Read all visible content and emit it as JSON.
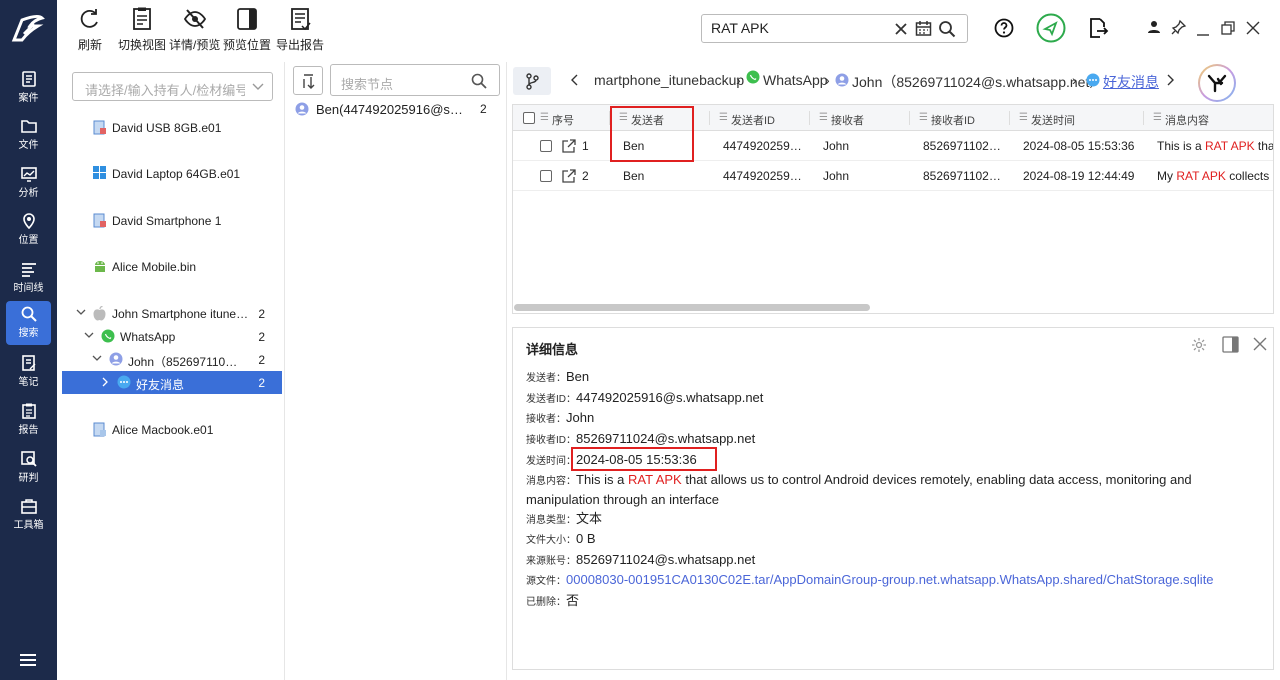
{
  "nav": {
    "items": [
      {
        "label": "案件",
        "icon": "case-icon"
      },
      {
        "label": "文件",
        "icon": "folder-icon"
      },
      {
        "label": "分析",
        "icon": "analysis-icon"
      },
      {
        "label": "位置",
        "icon": "location-icon"
      },
      {
        "label": "时间线",
        "icon": "timeline-icon"
      },
      {
        "label": "搜索",
        "icon": "search-icon"
      },
      {
        "label": "笔记",
        "icon": "note-icon"
      },
      {
        "label": "报告",
        "icon": "report-icon"
      },
      {
        "label": "研判",
        "icon": "judge-icon"
      },
      {
        "label": "工具箱",
        "icon": "toolbox-icon"
      }
    ],
    "active": "搜索"
  },
  "toolbar": {
    "refresh": "刷新",
    "switch_view": "切换视图",
    "detail_preview": "详情/预览",
    "preview_pos": "预览位置",
    "export_report": "导出报告"
  },
  "search": {
    "value": "RAT APK"
  },
  "tree": {
    "placeholder": "请选择/输入持有人/检材编号",
    "items": [
      {
        "label": "David USB 8GB.e01"
      },
      {
        "label": "David Laptop 64GB.e01"
      },
      {
        "label": "David Smartphone 1"
      },
      {
        "label": "Alice Mobile.bin"
      },
      {
        "label": "John Smartphone itunebackup",
        "count": "2"
      },
      {
        "label": "WhatsApp",
        "count": "2"
      },
      {
        "label": "John（85269711024@s.whatsapp.net）",
        "count": "2"
      },
      {
        "label": "好友消息",
        "count": "2"
      },
      {
        "label": "Alice Macbook.e01"
      }
    ]
  },
  "nodes": {
    "placeholder": "搜索节点",
    "items": [
      {
        "label": "Ben(447492025916@s.whatsapp.net)",
        "count": "2"
      }
    ]
  },
  "breadcrumb": {
    "part1": "martphone_itunebackup",
    "part2": "WhatsApp",
    "part3": "John（85269711024@s.whatsapp.net）",
    "part4": "好友消息"
  },
  "table": {
    "headers": [
      "序号",
      "发送者",
      "发送者ID",
      "接收者",
      "接收者ID",
      "发送时间",
      "消息内容"
    ],
    "rows": [
      {
        "no": "1",
        "sender": "Ben",
        "sender_id": "447492025916@s.whatsapp.net",
        "receiver": "John",
        "receiver_id": "85269711024@s.whatsapp.net",
        "time": "2024-08-05 15:53:36",
        "msg_pre": "This is a ",
        "msg_hl": "RAT APK",
        "msg_post": " that allows us to control Android devices remotely"
      },
      {
        "no": "2",
        "sender": "Ben",
        "sender_id": "447492025916@s.whatsapp.net",
        "receiver": "John",
        "receiver_id": "85269711024@s.whatsapp.net",
        "time": "2024-08-19 12:44:49",
        "msg_pre": "My ",
        "msg_hl": "RAT APK",
        "msg_post": " collects sensitive data"
      }
    ]
  },
  "detail": {
    "title": "详细信息",
    "sender_k": "发送者：",
    "sender_v": "Ben",
    "sender_id_k": "发送者ID：",
    "sender_id_v": "447492025916@s.whatsapp.net",
    "receiver_k": "接收者：",
    "receiver_v": "John",
    "receiver_id_k": "接收者ID：",
    "receiver_id_v": "85269711024@s.whatsapp.net",
    "time_k": "发送时间：",
    "time_v": "2024-08-05 15:53:36",
    "content_k": "消息内容：",
    "content_pre": "This is a ",
    "content_hl": "RAT APK",
    "content_post": " that allows us to control Android devices remotely, enabling data access, monitoring and manipulation through an interface",
    "type_k": "消息类型：",
    "type_v": "文本",
    "size_k": "文件大小：",
    "size_v": "0 B",
    "source_k": "来源账号：",
    "source_v": "85269711024@s.whatsapp.net",
    "file_k": "源文件：",
    "file_v": "00008030-001951CA0130C02E.tar/AppDomainGroup-group.net.whatsapp.WhatsApp.shared/ChatStorage.sqlite",
    "deleted_k": "已删除：",
    "deleted_v": "否"
  },
  "colors": {
    "nav_bg": "#1c2a4a",
    "accent": "#3a6fd8",
    "highlight": "#e02020",
    "link": "#4b66d8"
  }
}
